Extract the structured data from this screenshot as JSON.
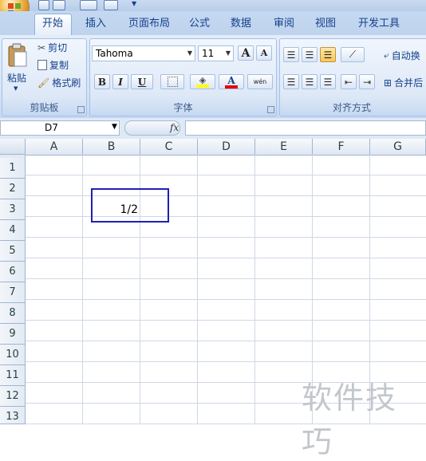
{
  "ribbon": {
    "tabs": [
      "开始",
      "插入",
      "页面布局",
      "公式",
      "数据",
      "审阅",
      "视图",
      "开发工具"
    ],
    "clipboard": {
      "paste": "粘贴",
      "cut": "剪切",
      "copy": "复制",
      "format_painter": "格式刷",
      "label": "剪贴板"
    },
    "font": {
      "name": "Tahoma",
      "size": "11",
      "label": "字体",
      "grow": "A",
      "shrink": "A",
      "bold": "B",
      "italic": "I",
      "underline": "U",
      "font_color": "A",
      "phonetic": "wén"
    },
    "alignment": {
      "wrap": "自动换",
      "merge": "合并后",
      "label": "对齐方式"
    }
  },
  "formula_bar": {
    "name_box": "D7",
    "fx": "fx",
    "formula": ""
  },
  "sheet": {
    "columns": [
      "A",
      "B",
      "C",
      "D",
      "E",
      "F",
      "G"
    ],
    "rows": [
      "1",
      "2",
      "3",
      "4",
      "5",
      "6",
      "7",
      "8",
      "9",
      "10",
      "11",
      "12",
      "13"
    ],
    "cell_b3": "1/2"
  },
  "watermark": "软件技巧",
  "colors": {
    "highlight": "#1f1fb3",
    "font_color_bar": "#e60000",
    "fill_color_bar": "#ffff00"
  }
}
